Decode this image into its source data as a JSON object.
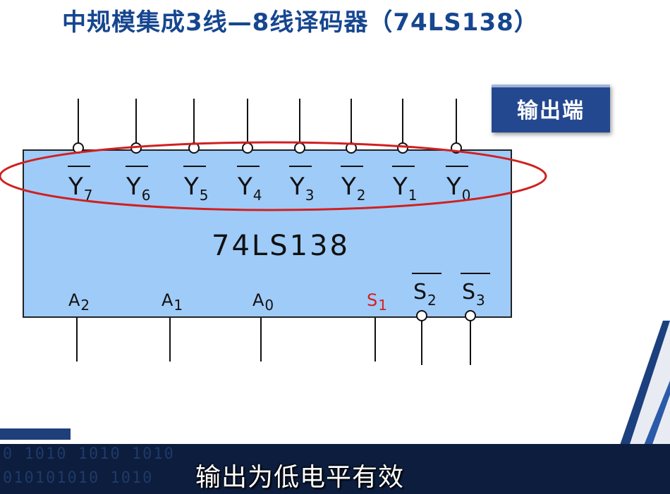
{
  "title": "中规模集成3线—8线译码器（74LS138）",
  "badge": "输出端",
  "chip": {
    "name": "74LS138",
    "outputs": [
      {
        "base": "Y",
        "sub": "7"
      },
      {
        "base": "Y",
        "sub": "6"
      },
      {
        "base": "Y",
        "sub": "5"
      },
      {
        "base": "Y",
        "sub": "4"
      },
      {
        "base": "Y",
        "sub": "3"
      },
      {
        "base": "Y",
        "sub": "2"
      },
      {
        "base": "Y",
        "sub": "1"
      },
      {
        "base": "Y",
        "sub": "0"
      }
    ],
    "inputs": [
      {
        "base": "A",
        "sub": "2",
        "color": "#111111"
      },
      {
        "base": "A",
        "sub": "1",
        "color": "#111111"
      },
      {
        "base": "A",
        "sub": "0",
        "color": "#111111"
      },
      {
        "base": "S",
        "sub": "1",
        "color": "#d42020"
      },
      {
        "base": "S",
        "sub": "2",
        "color": "#111111"
      },
      {
        "base": "S",
        "sub": "3",
        "color": "#111111"
      }
    ]
  },
  "colors": {
    "chip_fill": "#9fcbf8",
    "highlight_ellipse": "#d02020",
    "title": "#16468f"
  },
  "footer": {
    "binary_top": "0 1010 1010 1010",
    "binary_bottom": "010101010 1010",
    "subtitle": "输出为低电平有效"
  }
}
